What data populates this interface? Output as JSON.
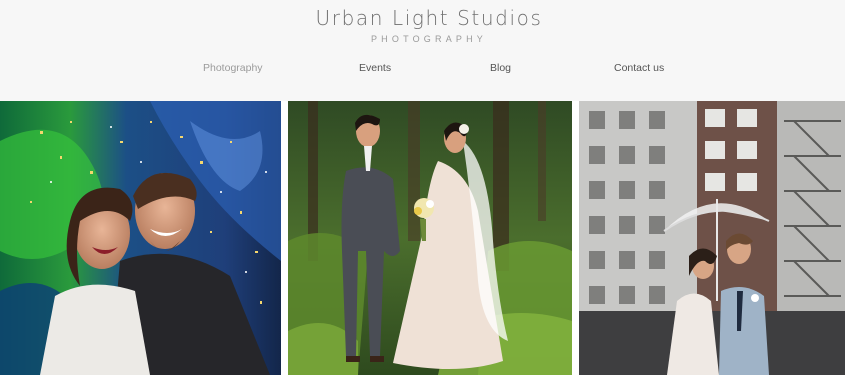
{
  "brand": {
    "title": "Urban Light Studios",
    "subtitle": "PHOTOGRAPHY"
  },
  "nav": {
    "items": [
      {
        "label": "Photography",
        "active": true
      },
      {
        "label": "Events",
        "active": false
      },
      {
        "label": "Blog",
        "active": false
      },
      {
        "label": "Contact us",
        "active": false
      }
    ]
  },
  "gallery": {
    "photos": [
      {
        "subject": "laughing couple in confetti against graffiti wall"
      },
      {
        "subject": "bride and groom facing each other in fern forest"
      },
      {
        "subject": "couple under clear umbrella in front of city buildings"
      }
    ]
  },
  "colors": {
    "header_bg": "#f7f7f7",
    "title": "#6f6f6f",
    "nav_text": "#555555",
    "nav_active": "#9b9b9b"
  }
}
